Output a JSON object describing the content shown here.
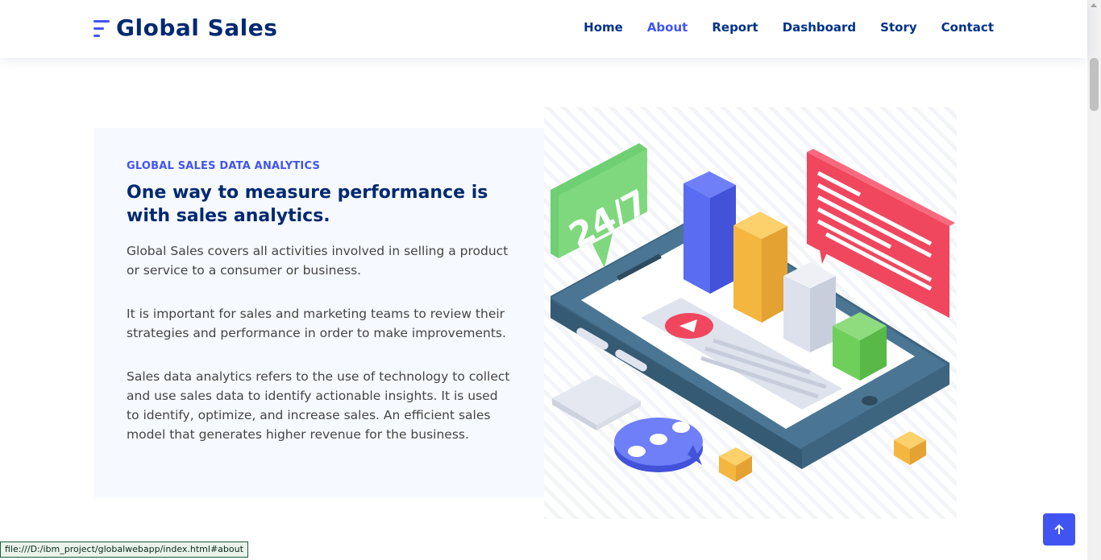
{
  "brand": {
    "name": "Global Sales",
    "accent": "#4154f1",
    "dark": "#012970"
  },
  "nav": {
    "items": [
      {
        "label": "Home",
        "active": false
      },
      {
        "label": "About",
        "active": true
      },
      {
        "label": "Report",
        "active": false
      },
      {
        "label": "Dashboard",
        "active": false
      },
      {
        "label": "Story",
        "active": false
      },
      {
        "label": "Contact",
        "active": false
      }
    ]
  },
  "about": {
    "eyebrow": "GLOBAL SALES DATA ANALYTICS",
    "headline": "One way to measure performance is with sales analytics.",
    "paragraphs": [
      "Global Sales covers all activities involved in selling a product or service to a consumer or business.",
      "It is important for sales and marketing teams to review their strategies and performance in order to make improvements.",
      "Sales data analytics refers to the use of technology to collect and use sales data to identify actionable insights. It is used to identify, optimize, and increase sales. An efficient sales model that generates higher revenue for the business."
    ]
  },
  "illustration": {
    "badge_text": "24/7",
    "icon": "analytics-tablet-illustration"
  },
  "status_bar": {
    "url": "file:///D:/ibm_project/globalwebapp/index.html#about"
  },
  "back_to_top": {
    "icon": "arrow-up-icon"
  }
}
